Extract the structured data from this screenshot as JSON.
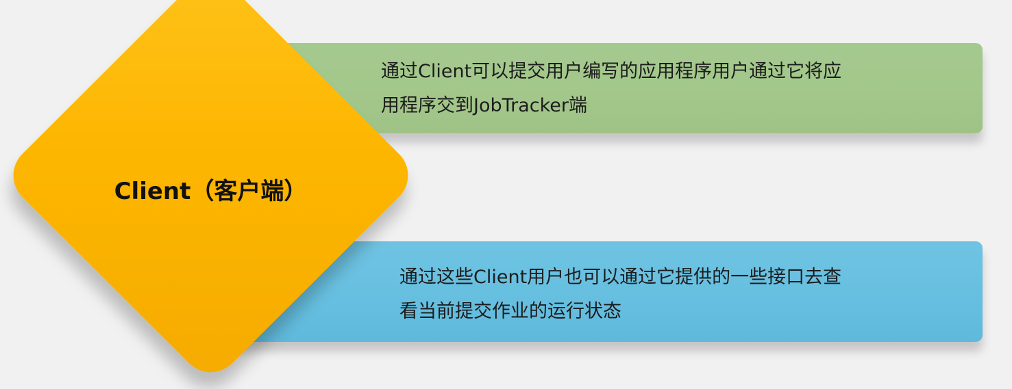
{
  "diagram": {
    "center_node": {
      "label": "Client（客户端）",
      "color": "#fdb600"
    },
    "descriptions": [
      {
        "lines": [
          "通过Client可以提交用户编写的应用程序用户通过它将应",
          "用程序交到JobTracker端"
        ],
        "color": "#a3c78b"
      },
      {
        "lines": [
          "通过这些Client用户也可以通过它提供的一些接口去查",
          "看当前提交作业的运行状态"
        ],
        "color": "#66bfe0"
      }
    ]
  }
}
